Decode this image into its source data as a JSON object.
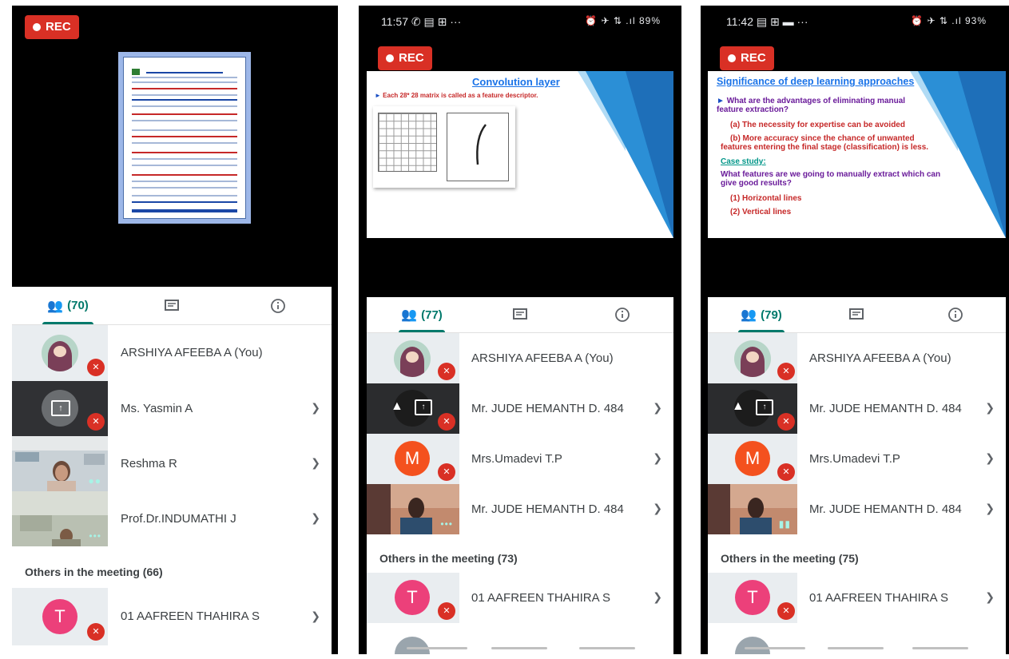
{
  "colors": {
    "accent": "#00796b",
    "rec": "#d93025",
    "mute": "#d93025",
    "avatar_m": "#f4511e",
    "avatar_t": "#ec407a"
  },
  "phones": [
    {
      "rec_label": "REC",
      "tabs": {
        "people_count": "(70)"
      },
      "participants": [
        {
          "name": "ARSHIYA AFEEBA A (You)"
        },
        {
          "name": "Ms. Yasmin A"
        },
        {
          "name": "Reshma R"
        },
        {
          "name": "Prof.Dr.INDUMATHI J"
        }
      ],
      "others_label": "Others in the meeting (66)",
      "others": [
        {
          "initial": "T",
          "name": "01 AAFREEN THAHIRA S"
        }
      ]
    },
    {
      "status_time": "11:57",
      "status_icons": "✆ ▤ ⊞ ···",
      "status_right": "⏰ ✈ ⇅ .ıl 89%",
      "rec_label": "REC",
      "slide": {
        "title": "Convolution layer",
        "bullet": "Each 28* 28 matrix is called as a feature descriptor."
      },
      "tabs": {
        "people_count": "(77)"
      },
      "participants": [
        {
          "name": "ARSHIYA AFEEBA A (You)"
        },
        {
          "name": "Mr. JUDE HEMANTH D. 484"
        },
        {
          "initial": "M",
          "name": "Mrs.Umadevi T.P"
        },
        {
          "name": "Mr. JUDE HEMANTH D. 484"
        }
      ],
      "others_label": "Others in the meeting (73)",
      "others": [
        {
          "initial": "T",
          "name": "01 AAFREEN THAHIRA S"
        }
      ]
    },
    {
      "status_time": "11:42",
      "status_icons": "▤ ⊞ ▬ ···",
      "status_right": "⏰ ✈ ⇅ .ıl 93%",
      "rec_label": "REC",
      "slide": {
        "title": "Significance of deep learning approaches",
        "q1": "What are the advantages of eliminating manual feature extraction?",
        "a1": "(a) The necessity for expertise can be avoided",
        "a2": "(b) More accuracy since the chance of unwanted features entering the final stage (classification) is less.",
        "case": "Case study:",
        "q2": "What features are we going to manually extract which can give good results?",
        "l1": "(1) Horizontal lines",
        "l2": "(2) Vertical lines"
      },
      "tabs": {
        "people_count": "(79)"
      },
      "participants": [
        {
          "name": "ARSHIYA AFEEBA A (You)"
        },
        {
          "name": "Mr. JUDE HEMANTH D. 484"
        },
        {
          "initial": "M",
          "name": "Mrs.Umadevi T.P"
        },
        {
          "name": "Mr. JUDE HEMANTH D. 484"
        }
      ],
      "others_label": "Others in the meeting (75)",
      "others": [
        {
          "initial": "T",
          "name": "01 AAFREEN THAHIRA S"
        }
      ]
    }
  ]
}
